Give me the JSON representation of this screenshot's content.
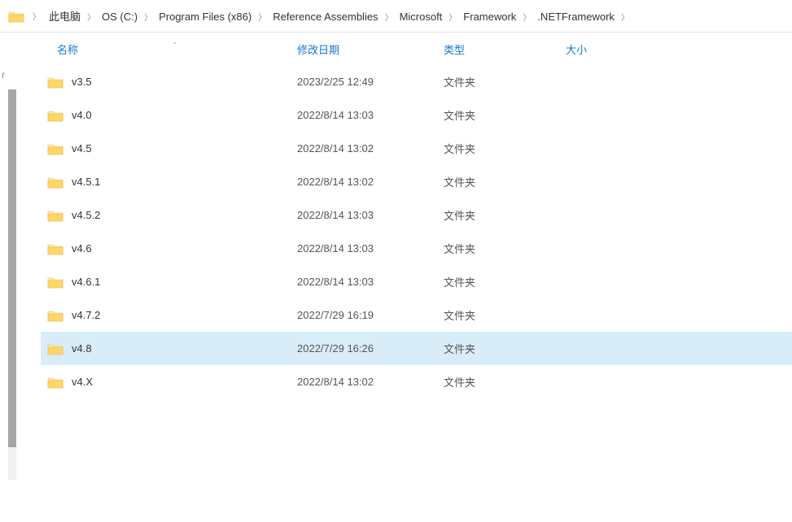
{
  "breadcrumb": [
    "此电脑",
    "OS (C:)",
    "Program Files (x86)",
    "Reference Assemblies",
    "Microsoft",
    "Framework",
    ".NETFramework"
  ],
  "columns": {
    "name": "名称",
    "date": "修改日期",
    "type": "类型",
    "size": "大小"
  },
  "left_truncated_char": "r",
  "rows": [
    {
      "name": "v3.5",
      "date": "2023/2/25 12:49",
      "type": "文件夹",
      "size": "",
      "selected": false
    },
    {
      "name": "v4.0",
      "date": "2022/8/14 13:03",
      "type": "文件夹",
      "size": "",
      "selected": false
    },
    {
      "name": "v4.5",
      "date": "2022/8/14 13:02",
      "type": "文件夹",
      "size": "",
      "selected": false
    },
    {
      "name": "v4.5.1",
      "date": "2022/8/14 13:02",
      "type": "文件夹",
      "size": "",
      "selected": false
    },
    {
      "name": "v4.5.2",
      "date": "2022/8/14 13:03",
      "type": "文件夹",
      "size": "",
      "selected": false
    },
    {
      "name": "v4.6",
      "date": "2022/8/14 13:03",
      "type": "文件夹",
      "size": "",
      "selected": false
    },
    {
      "name": "v4.6.1",
      "date": "2022/8/14 13:03",
      "type": "文件夹",
      "size": "",
      "selected": false
    },
    {
      "name": "v4.7.2",
      "date": "2022/7/29 16:19",
      "type": "文件夹",
      "size": "",
      "selected": false
    },
    {
      "name": "v4.8",
      "date": "2022/7/29 16:26",
      "type": "文件夹",
      "size": "",
      "selected": true
    },
    {
      "name": "v4.X",
      "date": "2022/8/14 13:02",
      "type": "文件夹",
      "size": "",
      "selected": false
    }
  ]
}
